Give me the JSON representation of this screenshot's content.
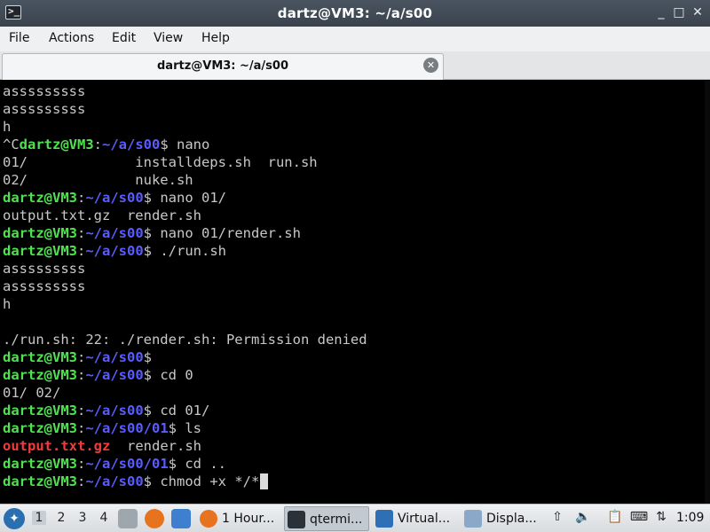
{
  "window": {
    "title": "dartz@VM3: ~/a/s00",
    "app_icon": "terminal-icon",
    "controls": {
      "minimize": "_",
      "maximize": "□",
      "close": "✕"
    }
  },
  "menu": [
    "File",
    "Actions",
    "Edit",
    "View",
    "Help"
  ],
  "tab": {
    "label": "dartz@VM3: ~/a/s00",
    "close_icon": "close-circle-icon",
    "close_glyph": "✕"
  },
  "terminal": {
    "colors": {
      "user": "#4ee34e",
      "path": "#5a5cff",
      "text": "#c8c8c8",
      "error": "#f03c3c",
      "background": "#000000"
    },
    "lines": [
      [
        {
          "t": "asssssssss",
          "c": "plain"
        }
      ],
      [
        {
          "t": "asssssssss",
          "c": "plain"
        }
      ],
      [
        {
          "t": "h",
          "c": "plain"
        }
      ],
      [
        {
          "t": "^C",
          "c": "plain"
        },
        {
          "t": "dartz@VM3",
          "c": "user"
        },
        {
          "t": ":",
          "c": "colon"
        },
        {
          "t": "~/a/s00",
          "c": "path"
        },
        {
          "t": "$ nano",
          "c": "plain"
        }
      ],
      [
        {
          "t": "01/             installdeps.sh  run.sh",
          "c": "plain"
        }
      ],
      [
        {
          "t": "02/             nuke.sh",
          "c": "plain"
        }
      ],
      [
        {
          "t": "dartz@VM3",
          "c": "user"
        },
        {
          "t": ":",
          "c": "colon"
        },
        {
          "t": "~/a/s00",
          "c": "path"
        },
        {
          "t": "$ nano 01/",
          "c": "plain"
        }
      ],
      [
        {
          "t": "output.txt.gz  render.sh",
          "c": "plain"
        }
      ],
      [
        {
          "t": "dartz@VM3",
          "c": "user"
        },
        {
          "t": ":",
          "c": "colon"
        },
        {
          "t": "~/a/s00",
          "c": "path"
        },
        {
          "t": "$ nano 01/render.sh",
          "c": "plain"
        }
      ],
      [
        {
          "t": "dartz@VM3",
          "c": "user"
        },
        {
          "t": ":",
          "c": "colon"
        },
        {
          "t": "~/a/s00",
          "c": "path"
        },
        {
          "t": "$ ./run.sh",
          "c": "plain"
        }
      ],
      [
        {
          "t": "asssssssss",
          "c": "plain"
        }
      ],
      [
        {
          "t": "asssssssss",
          "c": "plain"
        }
      ],
      [
        {
          "t": "h",
          "c": "plain"
        }
      ],
      [],
      [
        {
          "t": "./run.sh: 22: ./render.sh: Permission denied",
          "c": "plain"
        }
      ],
      [
        {
          "t": "dartz@VM3",
          "c": "user"
        },
        {
          "t": ":",
          "c": "colon"
        },
        {
          "t": "~/a/s00",
          "c": "path"
        },
        {
          "t": "$",
          "c": "plain"
        }
      ],
      [
        {
          "t": "dartz@VM3",
          "c": "user"
        },
        {
          "t": ":",
          "c": "colon"
        },
        {
          "t": "~/a/s00",
          "c": "path"
        },
        {
          "t": "$ cd 0",
          "c": "plain"
        }
      ],
      [
        {
          "t": "01/ 02/",
          "c": "plain"
        }
      ],
      [
        {
          "t": "dartz@VM3",
          "c": "user"
        },
        {
          "t": ":",
          "c": "colon"
        },
        {
          "t": "~/a/s00",
          "c": "path"
        },
        {
          "t": "$ cd 01/",
          "c": "plain"
        }
      ],
      [
        {
          "t": "dartz@VM3",
          "c": "user"
        },
        {
          "t": ":",
          "c": "colon"
        },
        {
          "t": "~/a/s00/01",
          "c": "path"
        },
        {
          "t": "$ ls",
          "c": "plain"
        }
      ],
      [
        {
          "t": "output.txt.gz",
          "c": "red"
        },
        {
          "t": "  render.sh",
          "c": "plain"
        }
      ],
      [
        {
          "t": "dartz@VM3",
          "c": "user"
        },
        {
          "t": ":",
          "c": "colon"
        },
        {
          "t": "~/a/s00/01",
          "c": "path"
        },
        {
          "t": "$ cd ..",
          "c": "plain"
        }
      ],
      [
        {
          "t": "dartz@VM3",
          "c": "user"
        },
        {
          "t": ":",
          "c": "colon"
        },
        {
          "t": "~/a/s00",
          "c": "path"
        },
        {
          "t": "$ chmod +x */*",
          "c": "plain"
        }
      ]
    ]
  },
  "taskbar": {
    "start_icon": "lxqt-menu-icon",
    "workspaces": [
      "1",
      "2",
      "3",
      "4"
    ],
    "active_workspace": "1",
    "launchers": [
      {
        "name": "file-manager-icon",
        "color": "#9ea7ad"
      },
      {
        "name": "firefox-icon",
        "color": "#e8731f"
      },
      {
        "name": "desktop-icon",
        "color": "#3e7fd0"
      }
    ],
    "tasks": [
      {
        "label": "1 Hour...",
        "icon": "firefox-icon",
        "color": "#e8731f",
        "active": false
      },
      {
        "label": "qtermi...",
        "icon": "terminal-icon",
        "color": "#2b3138",
        "active": true
      },
      {
        "label": "Virtual...",
        "icon": "virtualbox-icon",
        "color": "#2f6fb5",
        "active": false
      },
      {
        "label": "Displa...",
        "icon": "display-icon",
        "color": "#8aa9c8",
        "active": false
      }
    ],
    "tray": [
      {
        "name": "upload-icon",
        "glyph": "⇧"
      },
      {
        "name": "volume-icon",
        "glyph": "🔈"
      },
      {
        "name": "clipboard-icon",
        "glyph": "📋"
      },
      {
        "name": "keyboard-icon",
        "glyph": "⌨"
      },
      {
        "name": "network-icon",
        "glyph": "⇅"
      }
    ],
    "clock": "1:09"
  }
}
